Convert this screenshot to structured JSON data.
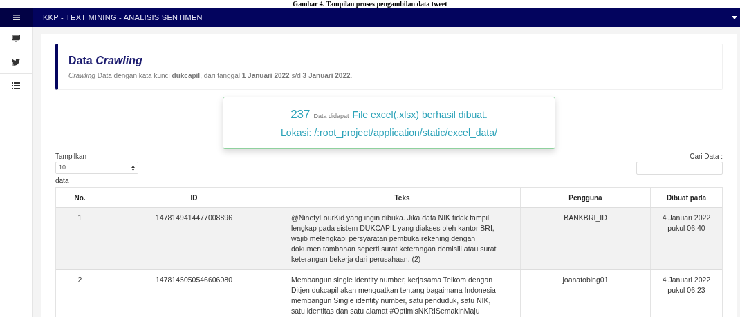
{
  "caption": "Gambar 4. Tampilan proses pengambilan data tweet",
  "header": {
    "title": "KKP - TEXT MINING - ANALISIS SENTIMEN"
  },
  "callout": {
    "title": "Data *Crawling*",
    "subtitle": "*Crawling* Data dengan kata kunci **dukcapil**, dari tanggal **1 Januari 2022** s/d **3 Januari 2022**."
  },
  "alert": {
    "count": "237",
    "count_label": "Data didapat",
    "message": "File excel(.xlsx) berhasil dibuat.",
    "location": "Lokasi: /:root_project/application/static/excel_data/"
  },
  "length_control": {
    "label": "Tampilkan",
    "value": "10",
    "suffix": "data"
  },
  "search": {
    "label": "Cari Data :"
  },
  "table": {
    "columns": [
      "No.",
      "ID",
      "Teks",
      "Pengguna",
      "Dibuat pada"
    ],
    "rows": [
      {
        "cells": [
          "1",
          "1478149414477008896",
          "@NinetyFourKid yang ingin dibuka. Jika data NIK tidak tampil lengkap pada sistem DUKCAPIL yang diakses oleh kantor BRI, wajib melengkapi persyaratan pembuka rekening dengan dokumen tambahan seperti surat keterangan domisili atau surat keterangan bekerja dari perusahaan. (2)",
          "BANKBRI_ID",
          "4 Januari 2022 pukul 06.40"
        ]
      },
      {
        "cells": [
          "2",
          "1478145050546606080",
          "Membangun single identity number, kerjasama Telkom dengan Ditjen dukcapil akan menguatkan tentang bagaimana Indonesia membangun Single identity number, satu penduduk, satu NIK, satu identitas dan satu alamat #OptimisNKRISemakinMaju",
          "joanatobing01",
          "4 Januari 2022 pukul 06.23"
        ]
      }
    ]
  }
}
